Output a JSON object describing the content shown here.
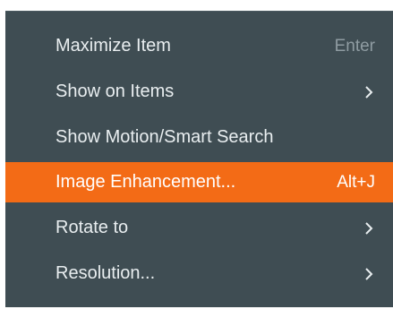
{
  "menu": {
    "items": [
      {
        "label": "Maximize Item",
        "shortcut": "Enter",
        "highlighted": false,
        "submenu": false
      },
      {
        "label": "Show on Items",
        "shortcut": "",
        "highlighted": false,
        "submenu": true,
        "submenu_icon": "chevron-right-icon"
      },
      {
        "label": "Show Motion/Smart Search",
        "shortcut": "",
        "highlighted": false,
        "submenu": false
      },
      {
        "label": "Image Enhancement...",
        "shortcut": "Alt+J",
        "highlighted": true,
        "submenu": false
      },
      {
        "label": "Rotate to",
        "shortcut": "",
        "highlighted": false,
        "submenu": true,
        "submenu_icon": "chevron-right-icon"
      },
      {
        "label": "Resolution...",
        "shortcut": "",
        "highlighted": false,
        "submenu": true,
        "submenu_icon": "chevron-right-icon"
      }
    ]
  },
  "colors": {
    "menu_background": "#3f4d53",
    "highlight": "#f36b16",
    "text": "#e9eef0",
    "shortcut_text": "#8f9ca2"
  }
}
